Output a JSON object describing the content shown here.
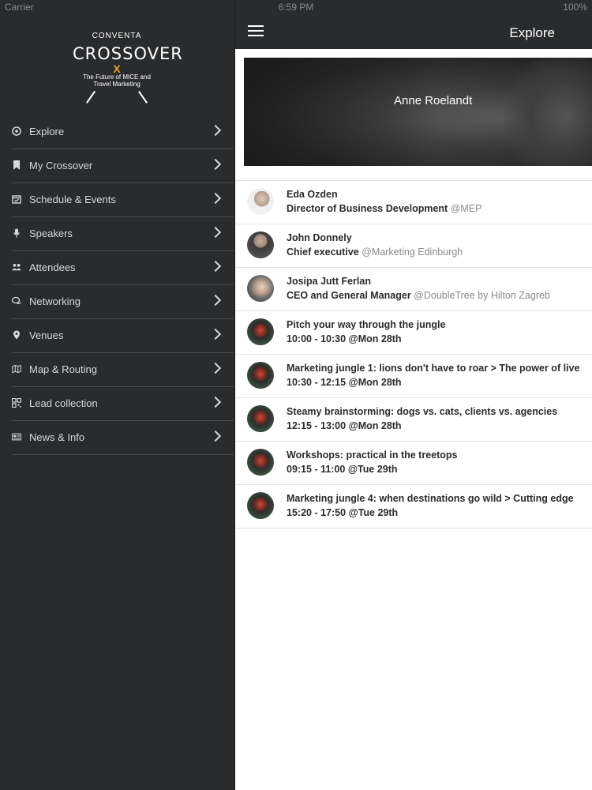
{
  "status_bar": {
    "carrier": "Carrier",
    "time": "6:59 PM",
    "battery": "100%"
  },
  "logo": {
    "small": "CONVENTA",
    "big": "CROSSOVER",
    "x": "X",
    "tag_line1": "The Future of MICE and",
    "tag_line2": "Travel Marketing"
  },
  "sidebar": {
    "items": [
      {
        "label": "Explore",
        "icon": "compass-icon"
      },
      {
        "label": "My Crossover",
        "icon": "bookmark-icon"
      },
      {
        "label": "Schedule & Events",
        "icon": "calendar-icon"
      },
      {
        "label": "Speakers",
        "icon": "microphone-icon"
      },
      {
        "label": "Attendees",
        "icon": "users-icon"
      },
      {
        "label": "Networking",
        "icon": "chat-icon"
      },
      {
        "label": "Venues",
        "icon": "map-pin-icon"
      },
      {
        "label": "Map & Routing",
        "icon": "map-icon"
      },
      {
        "label": "Lead collection",
        "icon": "qr-code-icon"
      },
      {
        "label": "News & Info",
        "icon": "newspaper-icon"
      }
    ]
  },
  "navbar": {
    "title": "Explore"
  },
  "hero": {
    "name": "Anne Roelandt"
  },
  "list": [
    {
      "line1": "Eda Ozden",
      "line2": "Director of Business Development",
      "org": "@MEP"
    },
    {
      "line1": "John Donnely",
      "line2": "Chief executive",
      "org": "@Marketing Edinburgh"
    },
    {
      "line1": "Josipa Jutt Ferlan",
      "line2": "CEO and General Manager",
      "org": "@DoubleTree by Hilton Zagreb"
    },
    {
      "line1": "Pitch your way through the jungle",
      "line2": "10:00 - 10:30 @Mon 28th",
      "org": ""
    },
    {
      "line1": "Marketing jungle 1: lions don't have to roar > The power of live",
      "line2": "10:30 - 12:15 @Mon 28th",
      "org": ""
    },
    {
      "line1": "Steamy brainstorming: dogs vs. cats, clients vs. agencies",
      "line2": "12:15 - 13:00 @Mon 28th",
      "org": ""
    },
    {
      "line1": "Workshops: practical in the treetops",
      "line2": "09:15 - 11:00 @Tue 29th",
      "org": ""
    },
    {
      "line1": "Marketing jungle 4: when destinations go wild > Cutting edge",
      "line2": "15:20 - 17:50 @Tue 29th",
      "org": ""
    }
  ]
}
